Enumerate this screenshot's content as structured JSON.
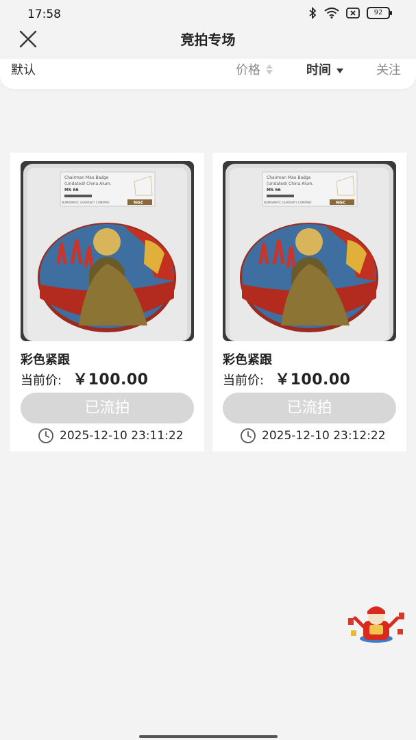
{
  "status": {
    "time": "17:58",
    "battery": "92",
    "icons": [
      "bluetooth-icon",
      "wifi-icon",
      "sim-off-icon",
      "battery-icon"
    ]
  },
  "header": {
    "title": "竞拍专场",
    "close_icon": "close-icon"
  },
  "filters": {
    "default": "默认",
    "price": "价格",
    "time": "时间",
    "follow": "关注"
  },
  "products": [
    {
      "name": "彩色紧跟",
      "price_label": "当前价:",
      "price": "￥100.00",
      "status": "已流拍",
      "time": "2025-12-10 23:11:22",
      "slab": {
        "line1": "Chairman Mao Badge",
        "line2": "(Undated) China Alum.",
        "grade": "MS 66",
        "footer": "NUMISMATIC GUARANTY COMPANY",
        "logo": "NGC"
      }
    },
    {
      "name": "彩色紧跟",
      "price_label": "当前价:",
      "price": "￥100.00",
      "status": "已流拍",
      "time": "2025-12-10 23:12:22",
      "slab": {
        "line1": "Chairman Mao Badge",
        "line2": "(Undated) China Alum.",
        "grade": "MS 66",
        "footer": "NUMISMATIC GUARANTY COMPANY",
        "logo": "NGC"
      }
    }
  ],
  "colors": {
    "background": "#f3f3f3",
    "button_disabled": "#d7d7d7",
    "text": "#222222"
  }
}
